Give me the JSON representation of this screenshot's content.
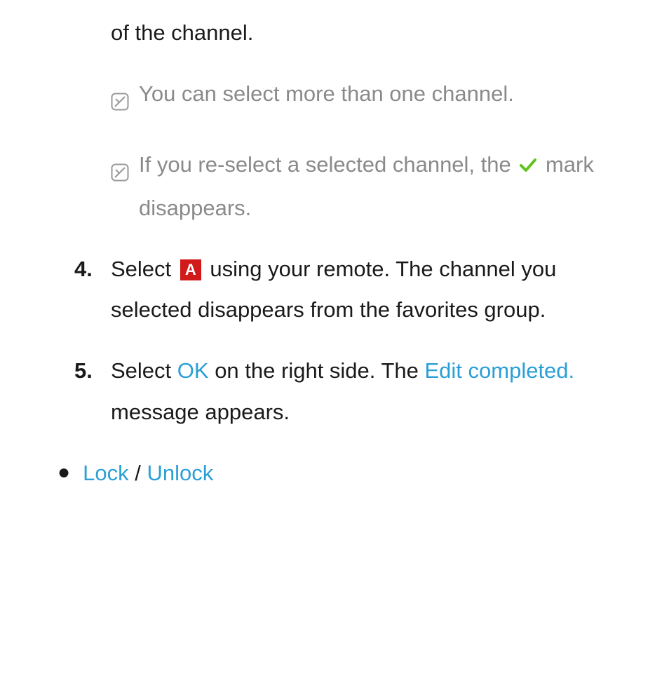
{
  "fragment": "of the channel.",
  "notes": [
    "You can select more than one channel.",
    {
      "pre": "If you re-select a selected channel, the ",
      "post": " mark disappears."
    }
  ],
  "steps": {
    "s4": {
      "num": "4.",
      "pre": "Select ",
      "key": "A",
      "post": " using your remote. The channel you selected disappears from the favorites group."
    },
    "s5": {
      "num": "5.",
      "t1": "Select ",
      "ok": "OK",
      "t2": " on the right side. The ",
      "edit": "Edit completed.",
      "t3": " message appears."
    }
  },
  "bullet": {
    "lock": "Lock",
    "sep": " / ",
    "unlock": "Unlock"
  }
}
